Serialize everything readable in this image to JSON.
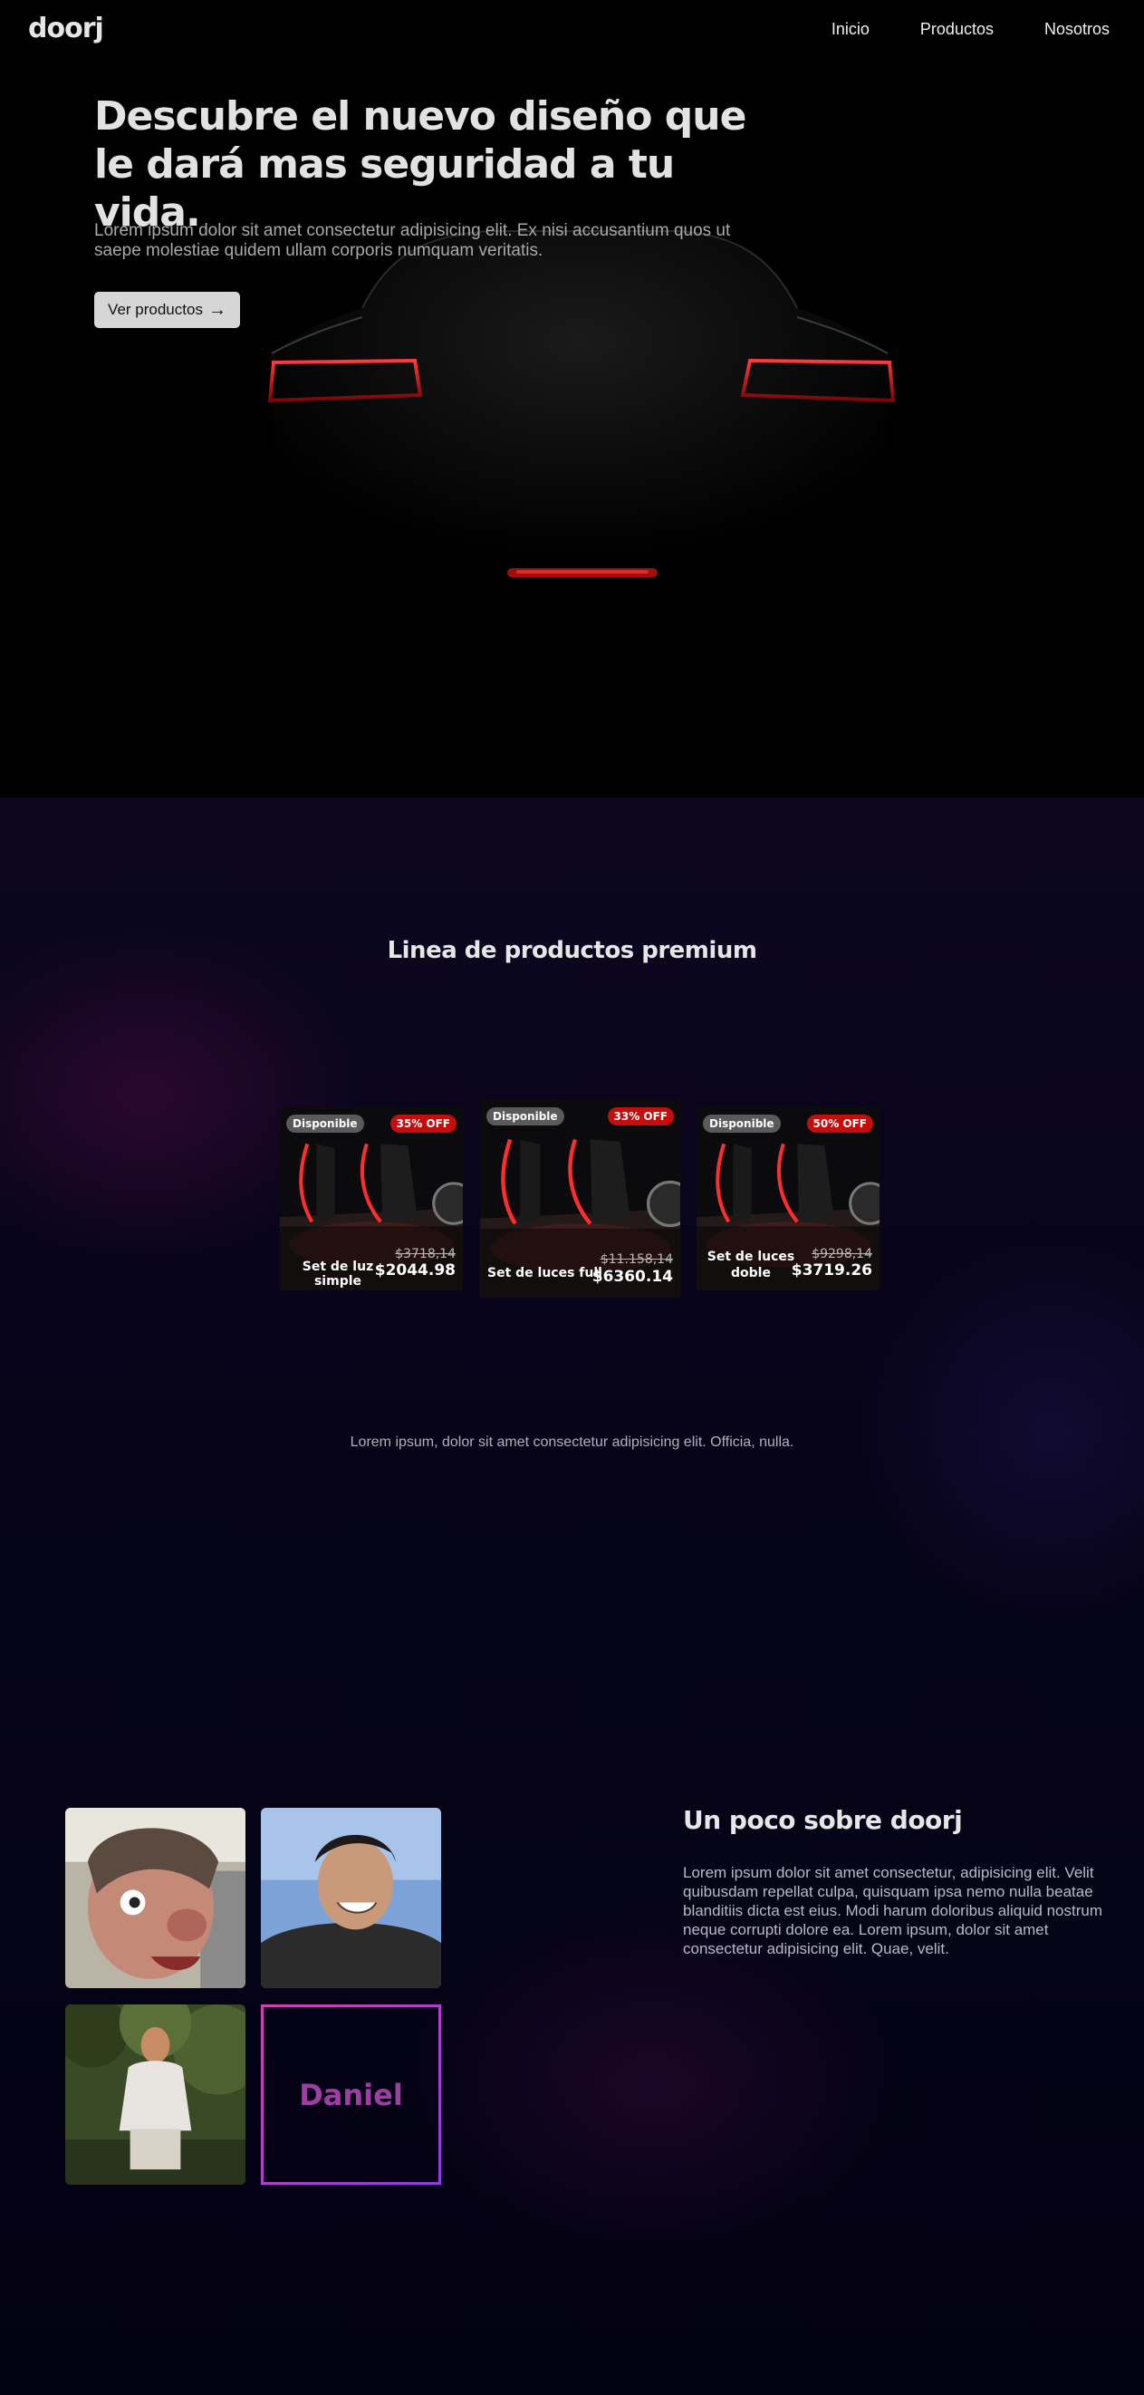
{
  "nav": {
    "logo": "doorj",
    "links": [
      "Inicio",
      "Productos",
      "Nosotros"
    ]
  },
  "hero": {
    "title": "Descubre el nuevo diseño que le dará mas seguridad a tu vida.",
    "text": "Lorem ipsum dolor sit amet consectetur adipisicing elit. Ex nisi accusantium quos ut saepe molestiae quidem ullam corporis numquam veritatis.",
    "button_label": "Ver productos",
    "button_icon": "arrow-right-icon"
  },
  "products": {
    "title": "Linea de productos premium",
    "note": "Lorem ipsum, dolor sit amet consectetur adipisicing elit. Officia, nulla.",
    "items": [
      {
        "status": "Disponible",
        "discount": "35% OFF",
        "name": "Set de luz simple",
        "old_price": "$3718,14",
        "price": "$2044.98"
      },
      {
        "status": "Disponible",
        "discount": "33% OFF",
        "name": "Set de luces full",
        "old_price": "$11.158,14",
        "price": "$6360.14"
      },
      {
        "status": "Disponible",
        "discount": "50% OFF",
        "name": "Set de luces doble",
        "old_price": "$9298,14",
        "price": "$3719.26"
      }
    ]
  },
  "about": {
    "title": "Un poco sobre doorj",
    "text": "Lorem ipsum dolor sit amet consectetur, adipisicing elit. Velit quibusdam repellat culpa, quisquam ipsa nemo nulla beatae blanditiis dicta est eius. Modi harum doloribus aliquid nostrum neque corrupti dolore ea. Lorem ipsum, dolor sit amet consectetur adipisicing elit. Quae, velit.",
    "team_name": "Daniel"
  },
  "colors": {
    "background": "#000000",
    "section_bg": "#07041a",
    "accent_red": "#c40d0d",
    "daniel_gradient_start": "#d63fb1",
    "daniel_gradient_end": "#8a3fe0"
  }
}
